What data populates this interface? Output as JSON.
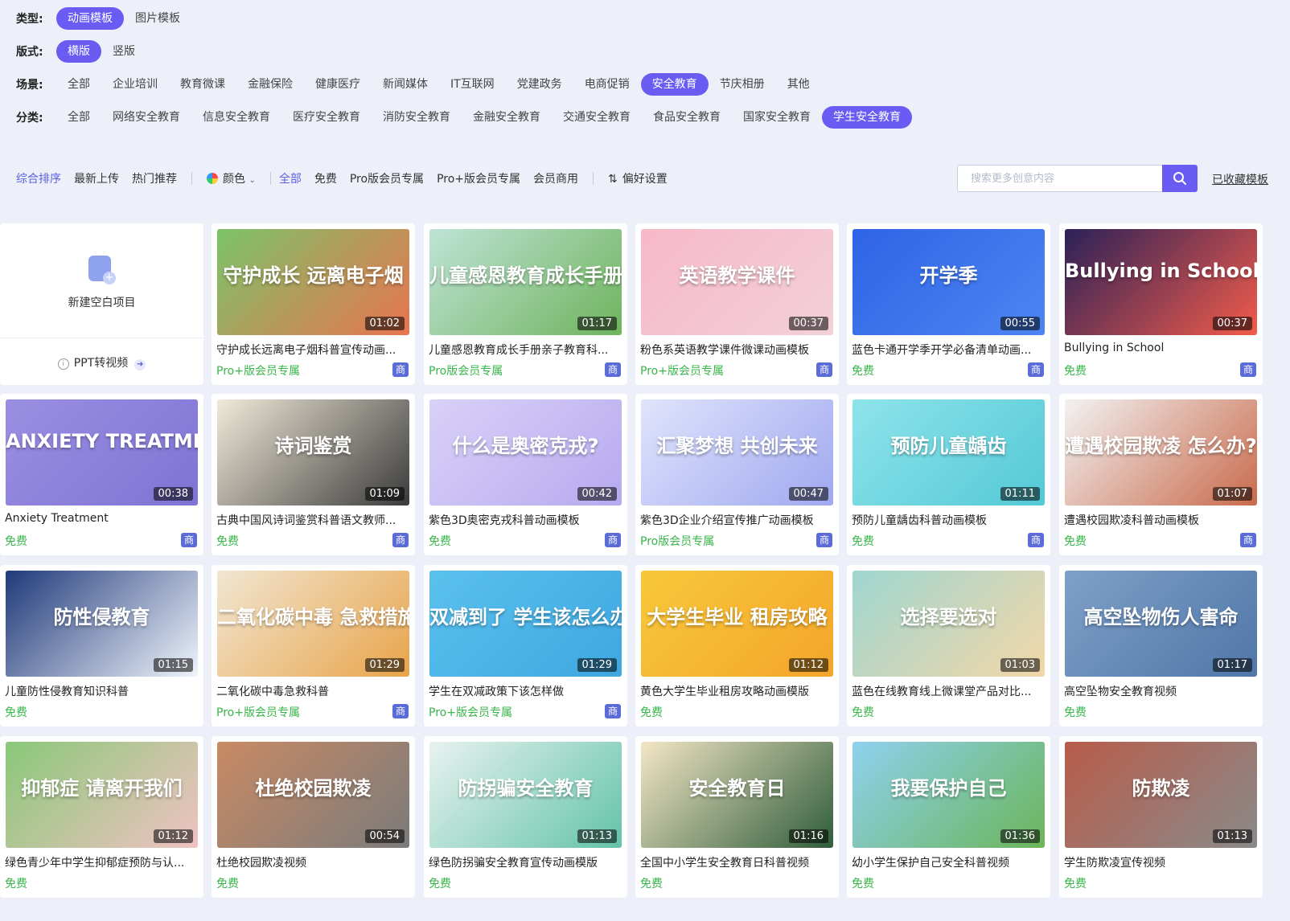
{
  "filters": {
    "type": {
      "label": "类型:",
      "items": [
        "动画模板",
        "图片模板"
      ],
      "active": 0
    },
    "layout": {
      "label": "版式:",
      "items": [
        "横版",
        "竖版"
      ],
      "active": 0
    },
    "scene": {
      "label": "场景:",
      "items": [
        "全部",
        "企业培训",
        "教育微课",
        "金融保险",
        "健康医疗",
        "新闻媒体",
        "IT互联网",
        "党建政务",
        "电商促销",
        "安全教育",
        "节庆相册",
        "其他"
      ],
      "active": 9
    },
    "category": {
      "label": "分类:",
      "items": [
        "全部",
        "网络安全教育",
        "信息安全教育",
        "医疗安全教育",
        "消防安全教育",
        "金融安全教育",
        "交通安全教育",
        "食品安全教育",
        "国家安全教育",
        "学生安全教育"
      ],
      "active": 9
    }
  },
  "toolbar": {
    "sort": [
      "综合排序",
      "最新上传",
      "热门推荐"
    ],
    "color_label": "颜色",
    "price": [
      "全部",
      "免费",
      "Pro版会员专属",
      "Pro+版会员专属",
      "会员商用"
    ],
    "prefs": "偏好设置",
    "search_placeholder": "搜索更多创意内容",
    "saved": "已收藏模板"
  },
  "blank_card": {
    "label": "新建空白项目",
    "ppt": "PPT转视频"
  },
  "badge_label": "商",
  "cards": [
    {
      "title": "守护成长远离电子烟科普宣传动画...",
      "price": "Pro+版会员专属",
      "duration": "01:02",
      "badge": true,
      "thumb_text": "守护成长 远离电子烟",
      "color1": "#7cc36a",
      "color2": "#e8744f"
    },
    {
      "title": "儿童感恩教育成长手册亲子教育科...",
      "price": "Pro版会员专属",
      "duration": "01:17",
      "badge": true,
      "thumb_text": "儿童感恩教育成长手册",
      "color1": "#bfe3d6",
      "color2": "#6eb35c"
    },
    {
      "title": "粉色系英语教学课件微课动画模板",
      "price": "Pro+版会员专属",
      "duration": "00:37",
      "badge": true,
      "thumb_text": "英语教学课件",
      "color1": "#f7b8c8",
      "color2": "#f2d0d8"
    },
    {
      "title": "蓝色卡通开学季开学必备清单动画...",
      "price": "免费",
      "duration": "00:55",
      "badge": true,
      "thumb_text": "开学季",
      "color1": "#2f63e6",
      "color2": "#4c86f2"
    },
    {
      "title": "Bullying in School",
      "price": "免费",
      "duration": "00:37",
      "badge": true,
      "thumb_text": "Bullying in School",
      "color1": "#2b2158",
      "color2": "#f25b4a"
    },
    {
      "title": "Anxiety Treatment",
      "price": "免费",
      "duration": "00:38",
      "badge": true,
      "thumb_text": "ANXIETY TREATMENT",
      "color1": "#9a8fe2",
      "color2": "#7f73d4"
    },
    {
      "title": "古典中国风诗词鉴赏科普语文教师...",
      "price": "免费",
      "duration": "01:09",
      "badge": true,
      "thumb_text": "诗词鉴赏",
      "color1": "#f1ead9",
      "color2": "#3b3b3b"
    },
    {
      "title": "紫色3D奥密克戎科普动画模板",
      "price": "免费",
      "duration": "00:42",
      "badge": true,
      "thumb_text": "什么是奥密克戎?",
      "color1": "#d9d1f7",
      "color2": "#b7a9f0"
    },
    {
      "title": "紫色3D企业介绍宣传推广动画模板",
      "price": "Pro版会员专属",
      "duration": "00:47",
      "badge": true,
      "thumb_text": "汇聚梦想 共创未来",
      "color1": "#e0e4fb",
      "color2": "#9fa8f0"
    },
    {
      "title": "预防儿童龋齿科普动画模板",
      "price": "免费",
      "duration": "01:11",
      "badge": true,
      "thumb_text": "预防儿童龋齿",
      "color1": "#8fe3ea",
      "color2": "#53c9d6"
    },
    {
      "title": "遭遇校园欺凌科普动画模板",
      "price": "免费",
      "duration": "01:07",
      "badge": true,
      "thumb_text": "遭遇校园欺凌 怎么办?",
      "color1": "#f2f2f2",
      "color2": "#c96a4b"
    },
    {
      "title": "儿童防性侵教育知识科普",
      "price": "免费",
      "duration": "01:15",
      "badge": false,
      "thumb_text": "防性侵教育",
      "color1": "#1f3a7a",
      "color2": "#f0f4fb"
    },
    {
      "title": "二氧化碳中毒急救科普",
      "price": "Pro+版会员专属",
      "duration": "01:29",
      "badge": true,
      "thumb_text": "二氧化碳中毒 急救措施",
      "color1": "#f1e6d2",
      "color2": "#e8a44a"
    },
    {
      "title": "学生在双减政策下该怎样做",
      "price": "Pro+版会员专属",
      "duration": "01:29",
      "badge": true,
      "thumb_text": "双减到了 学生该怎么办",
      "color1": "#5ac1ee",
      "color2": "#3ea7e0"
    },
    {
      "title": "黄色大学生毕业租房攻略动画模版",
      "price": "免费",
      "duration": "01:12",
      "badge": false,
      "thumb_text": "大学生毕业 租房攻略",
      "color1": "#f7c83b",
      "color2": "#f4a52a"
    },
    {
      "title": "蓝色在线教育线上微课堂产品对比...",
      "price": "免费",
      "duration": "01:03",
      "badge": false,
      "thumb_text": "选择要选对",
      "color1": "#9fd6d0",
      "color2": "#f3d7a8"
    },
    {
      "title": "高空坠物安全教育视频",
      "price": "免费",
      "duration": "01:17",
      "badge": false,
      "thumb_text": "高空坠物伤人害命",
      "color1": "#7fa0c8",
      "color2": "#4f77a8"
    },
    {
      "title": "绿色青少年中学生抑郁症预防与认...",
      "price": "免费",
      "duration": "01:12",
      "badge": false,
      "thumb_text": "抑郁症 请离开我们",
      "color1": "#89c878",
      "color2": "#f0c2c2"
    },
    {
      "title": "杜绝校园欺凌视频",
      "price": "免费",
      "duration": "00:54",
      "badge": false,
      "thumb_text": "杜绝校园欺凌",
      "color1": "#c98a64",
      "color2": "#7b7b7b"
    },
    {
      "title": "绿色防拐骗安全教育宣传动画模版",
      "price": "免费",
      "duration": "01:13",
      "badge": false,
      "thumb_text": "防拐骗安全教育",
      "color1": "#e8f2f0",
      "color2": "#63c3a8"
    },
    {
      "title": "全国中小学生安全教育日科普视频",
      "price": "免费",
      "duration": "01:16",
      "badge": false,
      "thumb_text": "安全教育日",
      "color1": "#f3e6c6",
      "color2": "#2f5d3a"
    },
    {
      "title": "幼小学生保护自己安全科普视频",
      "price": "免费",
      "duration": "01:36",
      "badge": false,
      "thumb_text": "我要保护自己",
      "color1": "#8fd1ef",
      "color2": "#6bb55a"
    },
    {
      "title": "学生防欺凌宣传视频",
      "price": "免费",
      "duration": "01:13",
      "badge": false,
      "thumb_text": "防欺凌",
      "color1": "#b85c4a",
      "color2": "#8a8a8a"
    }
  ]
}
